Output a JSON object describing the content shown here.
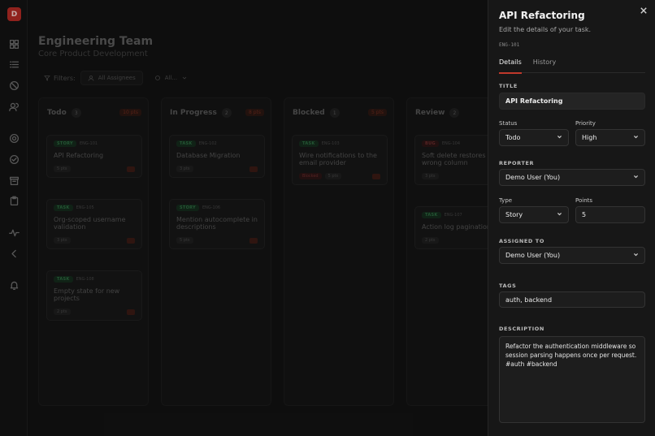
{
  "app": {
    "avatar_letter": "D"
  },
  "sidebar": {
    "items": [
      {
        "icon": "grid-icon"
      },
      {
        "icon": "list-icon"
      },
      {
        "icon": "block-icon"
      },
      {
        "icon": "users-icon"
      },
      {
        "icon": "gear-icon"
      },
      {
        "icon": "check-circle-icon"
      },
      {
        "icon": "archive-icon"
      },
      {
        "icon": "clipboard-icon"
      },
      {
        "icon": "activity-icon"
      },
      {
        "icon": "collapse-icon"
      },
      {
        "icon": "bell-icon"
      }
    ]
  },
  "board": {
    "team_title": "Engineering Team",
    "team_subtitle": "Core Product Development",
    "filters_label": "Filters:",
    "assignee_filter": "All Assignees",
    "type_filter": "All...",
    "columns": [
      {
        "title": "Todo",
        "count": "3",
        "points": "10 pts",
        "cards": [
          {
            "tag": "STORY",
            "id": "ENG-101",
            "title": "API Refactoring",
            "points": "5 pts"
          },
          {
            "tag": "TASK",
            "id": "ENG-105",
            "title": "Org-scoped username validation",
            "points": "3 pts"
          },
          {
            "tag": "TASK",
            "id": "ENG-108",
            "title": "Empty state for new projects",
            "points": "2 pts"
          }
        ]
      },
      {
        "title": "In Progress",
        "count": "2",
        "points": "8 pts",
        "cards": [
          {
            "tag": "TASK",
            "id": "ENG-102",
            "title": "Database Migration",
            "points": "3 pts"
          },
          {
            "tag": "STORY",
            "id": "ENG-106",
            "title": "Mention autocomplete in descriptions",
            "points": "5 pts"
          }
        ]
      },
      {
        "title": "Blocked",
        "count": "1",
        "points": "5 pts",
        "cards": [
          {
            "tag": "TASK",
            "id": "ENG-103",
            "title": "Wire notifications to the email provider",
            "points": "5 pts",
            "blocked": "Blocked"
          }
        ]
      },
      {
        "title": "Review",
        "count": "2",
        "points": "",
        "cards": [
          {
            "tag": "BUG",
            "id": "ENG-104",
            "title": "Soft delete restores the wrong column",
            "points": "3 pts"
          },
          {
            "tag": "TASK",
            "id": "ENG-107",
            "title": "Action log pagination",
            "points": "2 pts"
          }
        ]
      }
    ]
  },
  "drawer": {
    "title": "API Refactoring",
    "subtitle": "Edit the details of your task.",
    "task_id": "ENG-101",
    "tabs": [
      "Details",
      "History"
    ],
    "title_label": "TITLE",
    "title_value": "API Refactoring",
    "status_label": "Status",
    "status_value": "Todo",
    "priority_label": "Priority",
    "priority_value": "High",
    "reporter_label": "REPORTER",
    "reporter_value": "Demo User (You)",
    "type_label": "Type",
    "type_value": "Story",
    "points_label": "Points",
    "points_value": "5",
    "assigned_label": "ASSIGNED TO",
    "assigned_value": "Demo User (You)",
    "tags_label": "TAGS",
    "tags_value": "auth, backend",
    "description_label": "DESCRIPTION",
    "description_value": "Refactor the authentication middleware so session parsing happens once per request.\n#auth #backend"
  },
  "colors": {
    "accent": "#c0392b",
    "drawer_bg": "#171717",
    "board_bg": "#121212"
  }
}
